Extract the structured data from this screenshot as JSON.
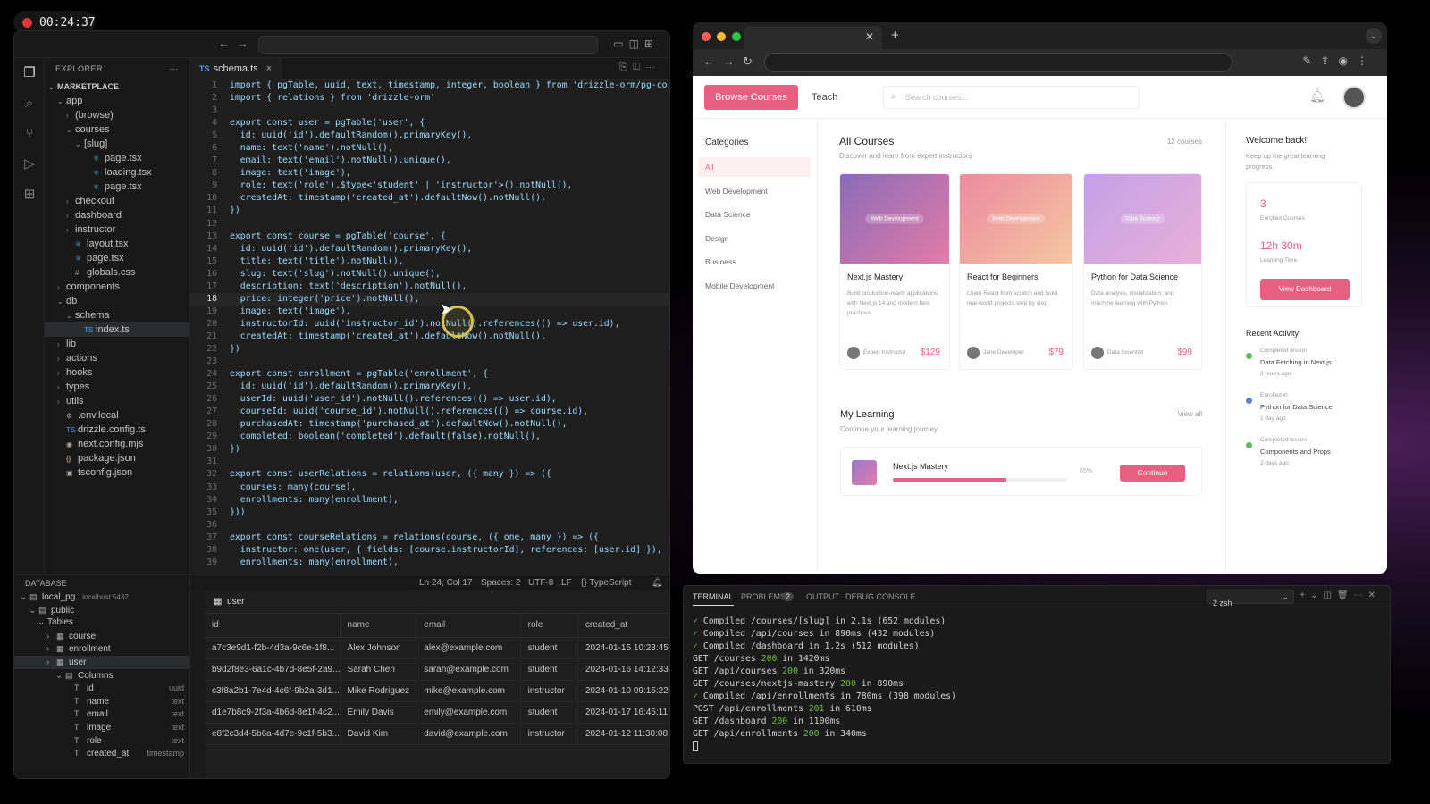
{
  "recording": {
    "time": "00:24:37"
  },
  "vscode": {
    "explorer": {
      "title": "EXPLORER",
      "more": "···",
      "tree": [
        {
          "label": "MARKETPLACE",
          "indent": 0,
          "chev": "v",
          "icon": "",
          "root": true
        },
        {
          "label": "app",
          "indent": 1,
          "chev": "v",
          "icon": ""
        },
        {
          "label": "(browse)",
          "indent": 2,
          "chev": ">",
          "icon": ""
        },
        {
          "label": "courses",
          "indent": 2,
          "chev": "v",
          "icon": ""
        },
        {
          "label": "[slug]",
          "indent": 3,
          "chev": "v",
          "icon": ""
        },
        {
          "label": "page.tsx",
          "indent": 4,
          "chev": "",
          "icon": "⚛"
        },
        {
          "label": "loading.tsx",
          "indent": 4,
          "chev": "",
          "icon": "⚛"
        },
        {
          "label": "page.tsx",
          "indent": 4,
          "chev": "",
          "icon": "⚛"
        },
        {
          "label": "checkout",
          "indent": 2,
          "chev": ">",
          "icon": ""
        },
        {
          "label": "dashboard",
          "indent": 2,
          "chev": ">",
          "icon": ""
        },
        {
          "label": "instructor",
          "indent": 2,
          "chev": ">",
          "icon": ""
        },
        {
          "label": "layout.tsx",
          "indent": 2,
          "chev": "",
          "icon": "⚛"
        },
        {
          "label": "page.tsx",
          "indent": 2,
          "chev": "",
          "icon": "⚛"
        },
        {
          "label": "globals.css",
          "indent": 2,
          "chev": "",
          "icon": "#"
        },
        {
          "label": "components",
          "indent": 1,
          "chev": ">",
          "icon": ""
        },
        {
          "label": "db",
          "indent": 1,
          "chev": "v",
          "icon": ""
        },
        {
          "label": "schema",
          "indent": 2,
          "chev": "v",
          "icon": ""
        },
        {
          "label": "index.ts",
          "indent": 3,
          "chev": "",
          "icon": "TS",
          "sel": true
        },
        {
          "label": "lib",
          "indent": 1,
          "chev": ">",
          "icon": ""
        },
        {
          "label": "actions",
          "indent": 1,
          "chev": ">",
          "icon": ""
        },
        {
          "label": "hooks",
          "indent": 1,
          "chev": ">",
          "icon": ""
        },
        {
          "label": "types",
          "indent": 1,
          "chev": ">",
          "icon": ""
        },
        {
          "label": "utils",
          "indent": 1,
          "chev": ">",
          "icon": ""
        },
        {
          "label": ".env.local",
          "indent": 1,
          "chev": "",
          "icon": "⚙"
        },
        {
          "label": "drizzle.config.ts",
          "indent": 1,
          "chev": "",
          "icon": "TS"
        },
        {
          "label": "next.config.mjs",
          "indent": 1,
          "chev": "",
          "icon": "◉"
        },
        {
          "label": "package.json",
          "indent": 1,
          "chev": "",
          "icon": "{}"
        },
        {
          "label": "tsconfig.json",
          "indent": 1,
          "chev": "",
          "icon": "▣"
        }
      ]
    },
    "tab": {
      "lang": "TS",
      "name": "schema.ts",
      "close": "×"
    },
    "code": [
      "import { pgTable, uuid, text, timestamp, integer, boolean } from 'drizzle-orm/pg-core'",
      "import { relations } from 'drizzle-orm'",
      "",
      "export const user = pgTable('user', {",
      "  id: uuid('id').defaultRandom().primaryKey(),",
      "  name: text('name').notNull(),",
      "  email: text('email').notNull().unique(),",
      "  image: text('image'),",
      "  role: text('role').$type<'student' | 'instructor'>().notNull(),",
      "  createdAt: timestamp('created_at').defaultNow().notNull(),",
      "})",
      "",
      "export const course = pgTable('course', {",
      "  id: uuid('id').defaultRandom().primaryKey(),",
      "  title: text('title').notNull(),",
      "  slug: text('slug').notNull().unique(),",
      "  description: text('description').notNull(),",
      "  price: integer('price').notNull(),",
      "  image: text('image'),",
      "  instructorId: uuid('instructor_id').notNull().references(() => user.id),",
      "  createdAt: timestamp('created_at').defaultNow().notNull(),",
      "})",
      "",
      "export const enrollment = pgTable('enrollment', {",
      "  id: uuid('id').defaultRandom().primaryKey(),",
      "  userId: uuid('user_id').notNull().references(() => user.id),",
      "  courseId: uuid('course_id').notNull().references(() => course.id),",
      "  purchasedAt: timestamp('purchased_at').defaultNow().notNull(),",
      "  completed: boolean('completed').default(false).notNull(),",
      "})",
      "",
      "export const userRelations = relations(user, ({ many }) => ({",
      "  courses: many(course),",
      "  enrollments: many(enrollment),",
      "}))",
      "",
      "export const courseRelations = relations(course, ({ one, many }) => ({",
      "  instructor: one(user, { fields: [course.instructorId], references: [user.id] }),",
      "  enrollments: many(enrollment),"
    ],
    "current_line": 18,
    "status": {
      "position": "Ln 24, Col 17",
      "spaces": "Spaces: 2",
      "encoding": "UTF-8",
      "eol": "LF",
      "language": "{} TypeScript"
    },
    "database": {
      "title": "DATABASE",
      "tree": [
        {
          "label": "local_pg",
          "indent": 0,
          "chev": "v",
          "icon": "▤",
          "extra": "localhost:5432"
        },
        {
          "label": "public",
          "indent": 1,
          "chev": "v",
          "icon": "▤"
        },
        {
          "label": "Tables",
          "indent": 2,
          "chev": "v",
          "icon": ""
        },
        {
          "label": "course",
          "indent": 3,
          "chev": ">",
          "icon": "▦"
        },
        {
          "label": "enrollment",
          "indent": 3,
          "chev": ">",
          "icon": "▦"
        },
        {
          "label": "user",
          "indent": 3,
          "chev": ">",
          "icon": "▦",
          "sel": true
        },
        {
          "label": "Columns",
          "indent": 4,
          "chev": "v",
          "icon": "▤"
        },
        {
          "label": "id",
          "indent": 5,
          "chev": "",
          "icon": "T",
          "type": "uuid"
        },
        {
          "label": "name",
          "indent": 5,
          "chev": "",
          "icon": "T",
          "type": "text"
        },
        {
          "label": "email",
          "indent": 5,
          "chev": "",
          "icon": "T",
          "type": "text"
        },
        {
          "label": "image",
          "indent": 5,
          "chev": "",
          "icon": "T",
          "type": "text"
        },
        {
          "label": "role",
          "indent": 5,
          "chev": "",
          "icon": "T",
          "type": "text"
        },
        {
          "label": "created_at",
          "indent": 5,
          "chev": "",
          "icon": "T",
          "type": "timestamp"
        }
      ]
    },
    "table": {
      "name": "user",
      "columns": [
        "id",
        "name",
        "email",
        "role",
        "created_at"
      ],
      "rows": [
        [
          "a7c3e9d1-f2b-4d3a-9c6e-1f8...",
          "Alex Johnson",
          "alex@example.com",
          "student",
          "2024-01-15 10:23:45"
        ],
        [
          "b9d2f8e3-6a1c-4b7d-8e5f-2a9...",
          "Sarah Chen",
          "sarah@example.com",
          "student",
          "2024-01-16 14:12:33"
        ],
        [
          "c3f8a2b1-7e4d-4c6f-9b2a-3d1...",
          "Mike Rodriguez",
          "mike@example.com",
          "instructor",
          "2024-01-10 09:15:22"
        ],
        [
          "d1e7b8c9-2f3a-4b6d-8e1f-4c2...",
          "Emily Davis",
          "emily@example.com",
          "student",
          "2024-01-17 16:45:11"
        ],
        [
          "e8f2c3d4-5b6a-4d7e-9c1f-5b3...",
          "David Kim",
          "david@example.com",
          "instructor",
          "2024-01-12 11:30:08"
        ]
      ]
    }
  },
  "browser": {
    "header": {
      "browse": "Browse Courses",
      "teach": "Teach",
      "search_placeholder": "Search courses..."
    },
    "categories": {
      "title": "Categories",
      "items": [
        "All",
        "Web Development",
        "Data Science",
        "Design",
        "Business",
        "Mobile Development"
      ]
    },
    "all_courses": {
      "title": "All Courses",
      "subtitle": "Discover and learn from expert instructors",
      "count": "12 courses"
    },
    "courses": [
      {
        "tag": "Web Development",
        "title": "Next.js Mastery",
        "desc": "Build production-ready applications with Next.js 14 and modern best practices.",
        "instructor": "Expert Instructor",
        "price": "$129",
        "c1": "#8a6bb8",
        "c2": "#e37ca8"
      },
      {
        "tag": "Web Development",
        "title": "React for Beginners",
        "desc": "Learn React from scratch and build real-world projects step by step.",
        "instructor": "Jane Developer",
        "price": "$79",
        "c1": "#ec8aa0",
        "c2": "#f5c8a0"
      },
      {
        "tag": "Data Science",
        "title": "Python for Data Science",
        "desc": "Data analysis, visualization, and machine learning with Python.",
        "instructor": "Data Scientist",
        "price": "$99",
        "c1": "#c4a0e8",
        "c2": "#e8b0d8"
      }
    ],
    "my_learning": {
      "title": "My Learning",
      "subtitle": "Continue your learning journey",
      "view_all": "View all",
      "course": "Next.js Mastery",
      "progress": 65,
      "progress_label": "65%",
      "button": "Continue"
    },
    "welcome": {
      "title": "Welcome back!",
      "subtitle": "Keep up the great learning progress.",
      "enrolled": "3",
      "enrolled_label": "Enrolled Courses",
      "time": "12h 30m",
      "time_label": "Learning Time",
      "button": "View Dashboard"
    },
    "recent": {
      "title": "Recent Activity",
      "items": [
        {
          "action": "Completed lesson",
          "what": "Data Fetching in Next.js",
          "when": "2 hours ago",
          "color": "#5cb85c"
        },
        {
          "action": "Enrolled in",
          "what": "Python for Data Science",
          "when": "1 day ago",
          "color": "#5b7fd6"
        },
        {
          "action": "Completed lesson",
          "what": "Components and Props",
          "when": "2 days ago",
          "color": "#5cb85c"
        }
      ]
    }
  },
  "terminal": {
    "tabs": [
      "TERMINAL",
      "PROBLEMS",
      "OUTPUT",
      "DEBUG CONSOLE"
    ],
    "problems_count": "2",
    "shell": "2 zsh",
    "lines": [
      {
        "ok": "✓",
        "text": "Compiled /courses/[slug] in 2.1s (652 modules)"
      },
      {
        "ok": "✓",
        "text": "Compiled /api/courses in 890ms (432 modules)"
      },
      {
        "ok": "✓",
        "text": "Compiled /dashboard in 1.2s (512 modules)"
      },
      {
        "pre": "GET /courses ",
        "code": "200",
        "post": " in 1420ms"
      },
      {
        "pre": "GET /api/courses ",
        "code": "200",
        "post": " in 320ms"
      },
      {
        "pre": "GET /courses/nextjs-mastery ",
        "code": "200",
        "post": " in 890ms"
      },
      {
        "ok": "✓",
        "text": "Compiled /api/enrollments in 780ms (398 modules)"
      },
      {
        "pre": "POST /api/enrollments ",
        "code": "201",
        "post": " in 610ms"
      },
      {
        "pre": "GET /dashboard ",
        "code": "200",
        "post": " in 1100ms"
      },
      {
        "pre": "GET /api/enrollments ",
        "code": "200",
        "post": " in 340ms"
      }
    ]
  }
}
